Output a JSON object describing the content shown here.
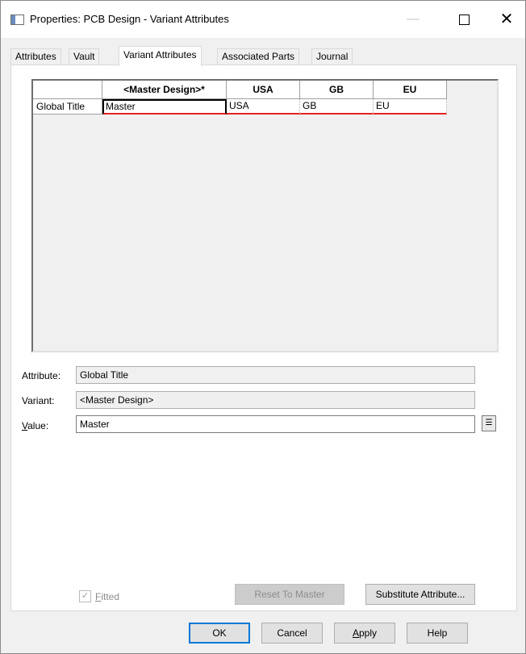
{
  "window": {
    "title": "Properties: PCB Design - Variant Attributes",
    "controls": {
      "minimize": "—",
      "maximize": "",
      "close": "✕"
    }
  },
  "tabs": [
    {
      "label": "Attributes",
      "active": false
    },
    {
      "label": "Vault",
      "active": false
    },
    {
      "label": "Variant Attributes",
      "active": true
    },
    {
      "label": "Associated Parts",
      "active": false
    },
    {
      "label": "Journal",
      "active": false
    }
  ],
  "grid": {
    "columns": [
      "<Master Design>*",
      "USA",
      "GB",
      "EU"
    ],
    "rows": [
      {
        "header": "Global Title",
        "values": [
          "Master",
          "USA",
          "GB",
          "EU"
        ]
      }
    ],
    "selected_cell": "Master",
    "highlight_color": "#e52222"
  },
  "details": {
    "attribute_label": "Attribute:",
    "attribute_value": "Global Title",
    "variant_label": "Variant:",
    "variant_value": "<Master Design>",
    "value_label": "Value:",
    "value_value": "Master",
    "value_label_mnemonic": "V",
    "value_label_rest": "alue:"
  },
  "fitted": {
    "label_mnemonic": "F",
    "label_rest": "itted",
    "checked": true,
    "enabled": false
  },
  "buttons": {
    "reset": "Reset To Master",
    "substitute": "Substitute Attribute...",
    "ok": "OK",
    "cancel": "Cancel",
    "apply_mnemonic": "A",
    "apply_rest": "pply",
    "help": "Help"
  },
  "icons": {
    "picker": "list-picker-icon",
    "check": "check-icon"
  }
}
